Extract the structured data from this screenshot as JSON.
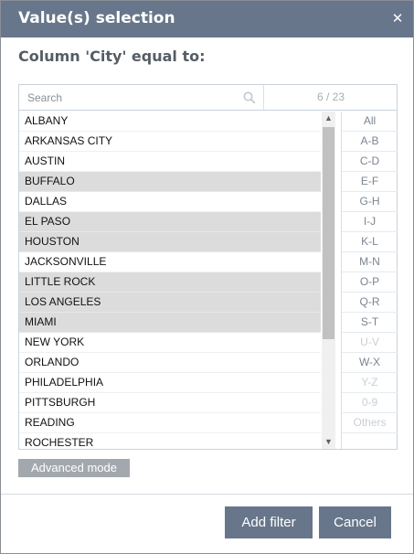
{
  "dialog": {
    "title": "Value(s) selection",
    "close_icon": "close-icon",
    "heading": "Column 'City' equal to:"
  },
  "search": {
    "placeholder": "Search",
    "icon": "search-icon",
    "counter": "6 / 23"
  },
  "list": {
    "items": [
      {
        "label": "ALBANY",
        "selected": false
      },
      {
        "label": "ARKANSAS CITY",
        "selected": false
      },
      {
        "label": "AUSTIN",
        "selected": false
      },
      {
        "label": "BUFFALO",
        "selected": true
      },
      {
        "label": "DALLAS",
        "selected": false
      },
      {
        "label": "EL PASO",
        "selected": true
      },
      {
        "label": "HOUSTON",
        "selected": true
      },
      {
        "label": "JACKSONVILLE",
        "selected": false
      },
      {
        "label": "LITTLE ROCK",
        "selected": true
      },
      {
        "label": "LOS ANGELES",
        "selected": true
      },
      {
        "label": "MIAMI",
        "selected": true
      },
      {
        "label": "NEW YORK",
        "selected": false
      },
      {
        "label": "ORLANDO",
        "selected": false
      },
      {
        "label": "PHILADELPHIA",
        "selected": false
      },
      {
        "label": "PITTSBURGH",
        "selected": false
      },
      {
        "label": "READING",
        "selected": false
      },
      {
        "label": "ROCHESTER",
        "selected": false
      }
    ]
  },
  "scrollbar": {
    "up_icon": "scroll-up-arrow-icon",
    "down_icon": "scroll-down-arrow-icon"
  },
  "alphabet": {
    "buttons": [
      {
        "label": "All",
        "enabled": true
      },
      {
        "label": "A-B",
        "enabled": true
      },
      {
        "label": "C-D",
        "enabled": true
      },
      {
        "label": "E-F",
        "enabled": true
      },
      {
        "label": "G-H",
        "enabled": true
      },
      {
        "label": "I-J",
        "enabled": true
      },
      {
        "label": "K-L",
        "enabled": true
      },
      {
        "label": "M-N",
        "enabled": true
      },
      {
        "label": "O-P",
        "enabled": true
      },
      {
        "label": "Q-R",
        "enabled": true
      },
      {
        "label": "S-T",
        "enabled": true
      },
      {
        "label": "U-V",
        "enabled": false
      },
      {
        "label": "W-X",
        "enabled": true
      },
      {
        "label": "Y-Z",
        "enabled": false
      },
      {
        "label": "0-9",
        "enabled": false
      },
      {
        "label": "Others",
        "enabled": false
      }
    ]
  },
  "advanced_mode_label": "Advanced mode",
  "footer": {
    "add_filter_label": "Add filter",
    "cancel_label": "Cancel"
  },
  "colors": {
    "title_bar": "#67768a",
    "selected_row": "#dcdcdc",
    "advanced_button": "#a3a8ae"
  }
}
